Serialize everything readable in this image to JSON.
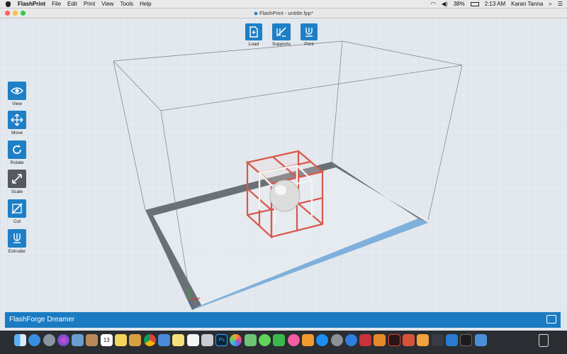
{
  "menubar": {
    "app_name": "FlashPrint",
    "items": [
      "File",
      "Edit",
      "Print",
      "View",
      "Tools",
      "Help"
    ],
    "battery": "38%",
    "time": "2:13 AM",
    "user": "Karan Tanna"
  },
  "window": {
    "title": "FlashPrint - untitle.fpp*"
  },
  "top_toolbar": {
    "load": "Load",
    "supports": "Supports",
    "print": "Print"
  },
  "left_toolbar": {
    "view": "View",
    "move": "Move",
    "rotate": "Rotate",
    "scale": "Scale",
    "cut": "Cut",
    "extruder": "Extruder"
  },
  "status": {
    "printer": "FlashForge Dreamer"
  },
  "dock": {
    "calendar_day": "13",
    "icons": [
      "finder-icon",
      "safari-icon",
      "launchpad-icon",
      "siri-icon",
      "preview-icon",
      "contacts-icon",
      "calendar-icon",
      "notes-icon",
      "photos-browser-icon",
      "chrome-icon",
      "keynote-icon",
      "notes-yellow-icon",
      "reminders-icon",
      "filemerge-icon",
      "photoshop-icon",
      "photos-icon",
      "maps-icon",
      "messages-icon",
      "facetime-icon",
      "itunes-icon",
      "ibooks-icon",
      "app-store-icon",
      "preferences-icon",
      "sourcetree-icon",
      "autocad-icon",
      "fontexplorer-icon",
      "acrobat-icon",
      "sublime-icon",
      "evernote-icon",
      "terminal-icon",
      "vscode-icon",
      "terminal-dark-icon",
      "android-studio-icon"
    ]
  },
  "colors": {
    "accent": "#1a7bc2",
    "model": "#d9574a",
    "dark_button": "#565a5f"
  }
}
